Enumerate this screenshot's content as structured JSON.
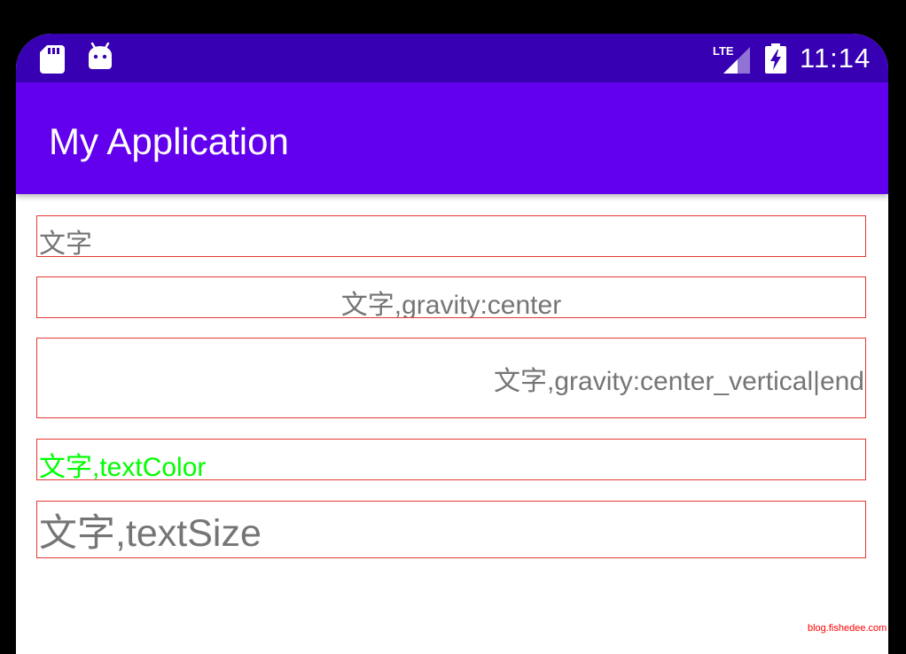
{
  "status_bar": {
    "time": "11:14",
    "network_label": "LTE",
    "icons": [
      "sd-card-icon",
      "android-debug-icon",
      "lte-signal-icon",
      "battery-charging-icon"
    ]
  },
  "app_bar": {
    "title": "My Application"
  },
  "text_views": [
    {
      "text": "文字"
    },
    {
      "text": "文字,gravity:center"
    },
    {
      "text": "文字,gravity:center_vertical|end"
    },
    {
      "text": "文字,textColor"
    },
    {
      "text": "文字,textSize"
    }
  ],
  "watermark": "blog.fishedee.com",
  "colors": {
    "status_bar": "#3700b3",
    "app_bar": "#6200ee",
    "border": "#e53935",
    "text_default": "#757575",
    "text_green": "#00ff00",
    "watermark": "#ff0000"
  }
}
